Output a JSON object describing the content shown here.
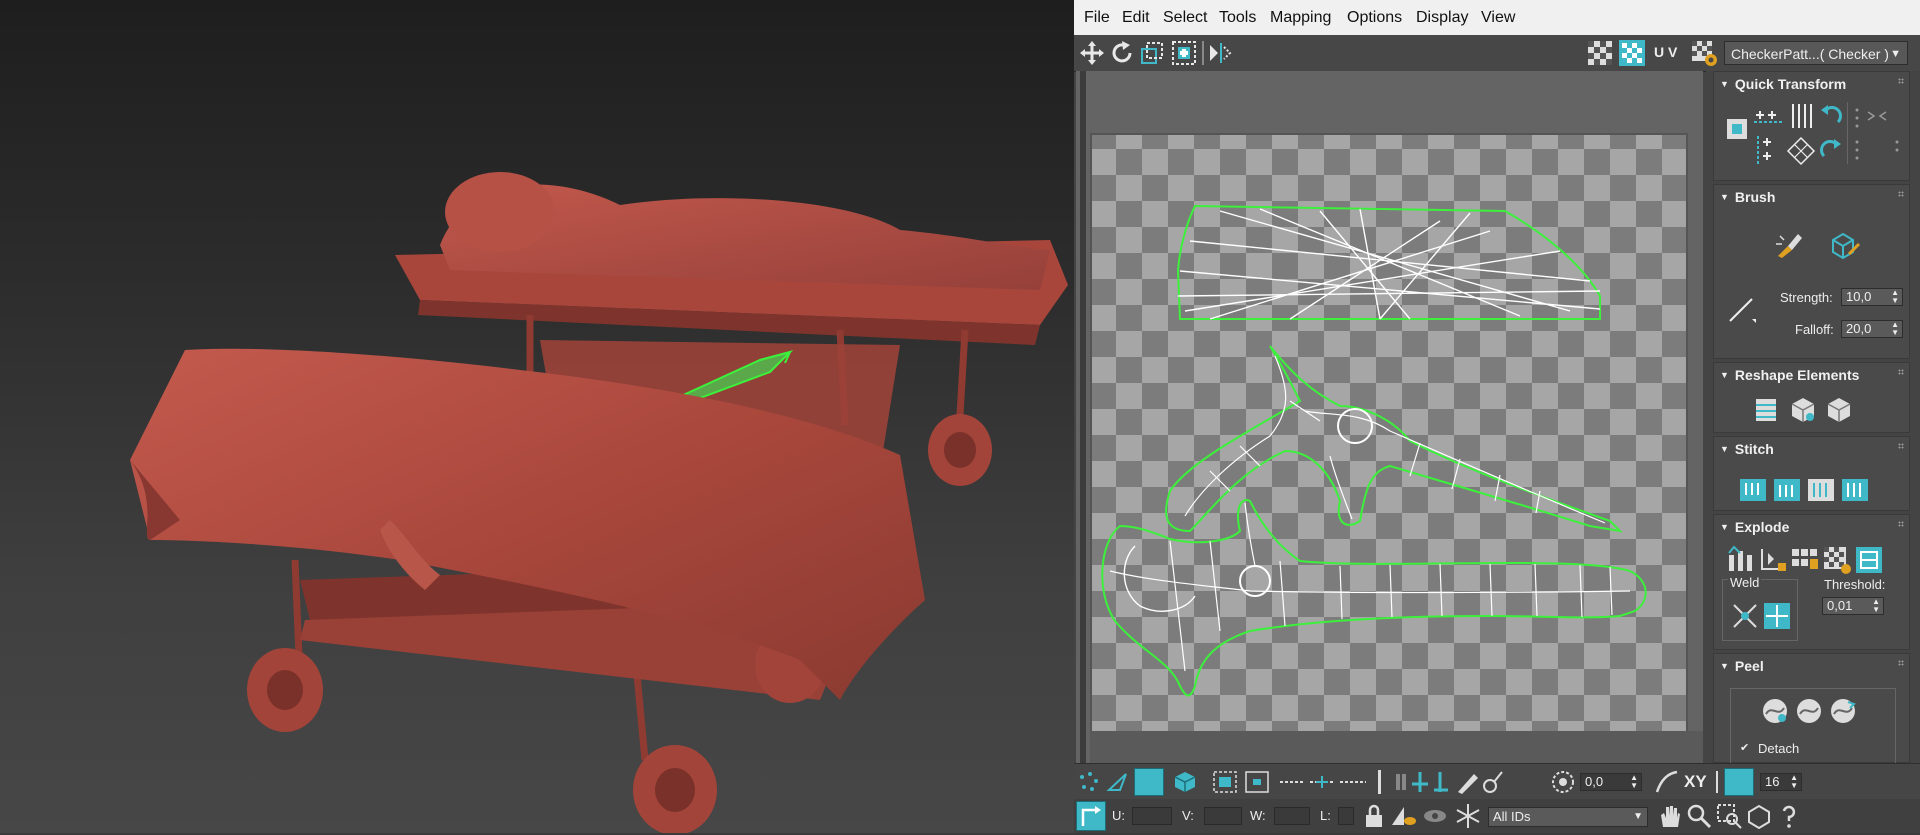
{
  "menu": {
    "items": [
      "File",
      "Edit",
      "Select",
      "Tools",
      "Mapping",
      "Options",
      "Display",
      "View"
    ]
  },
  "toolbar": {
    "uv_label": "U V",
    "texture_dropdown": "CheckerPatt...( Checker )"
  },
  "rollouts": {
    "quick_transform": {
      "title": "Quick Transform"
    },
    "brush": {
      "title": "Brush",
      "strength_label": "Strength:",
      "strength_value": "10,0",
      "falloff_label": "Falloff:",
      "falloff_value": "20,0"
    },
    "reshape": {
      "title": "Reshape Elements"
    },
    "stitch": {
      "title": "Stitch"
    },
    "explode": {
      "title": "Explode",
      "weld_label": "Weld",
      "threshold_label": "Threshold:",
      "threshold_value": "0,01"
    },
    "peel": {
      "title": "Peel",
      "detach_label": "Detach",
      "detach_checked": true
    }
  },
  "bottom": {
    "rotate_value": "0,0",
    "xy_label": "XY",
    "grid_value": "16",
    "u_label": "U:",
    "v_label": "V:",
    "w_label": "W:",
    "l_label": "L:",
    "ids_dropdown": "All IDs"
  },
  "colors": {
    "menu_bg": "#f0f0f0",
    "panel_bg": "#444444",
    "accent_cyan": "#3fb8c8",
    "uv_edge_green": "#3cf03c",
    "model_red": "#b24a3f"
  }
}
